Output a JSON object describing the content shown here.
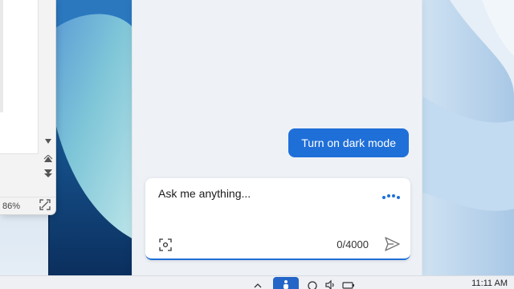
{
  "left_window": {
    "zoom_level": "86%",
    "icons": [
      "scroll-down-small-icon",
      "scroll-up-icon",
      "scroll-down-icon",
      "expand-icon"
    ]
  },
  "copilot": {
    "user_message": "Turn on dark mode",
    "composer": {
      "placeholder": "Ask me anything...",
      "char_count": "0/4000",
      "icons": [
        "typing-dots-icon",
        "screenshot-capture-icon",
        "send-icon"
      ]
    },
    "accent_color": "#1f6fd8"
  },
  "taskbar": {
    "clock_time": "11:11 AM",
    "active_color": "#2465c8",
    "icons": [
      "chevron-up-icon",
      "active-app-icon",
      "network-icon",
      "volume-icon",
      "battery-icon"
    ]
  }
}
